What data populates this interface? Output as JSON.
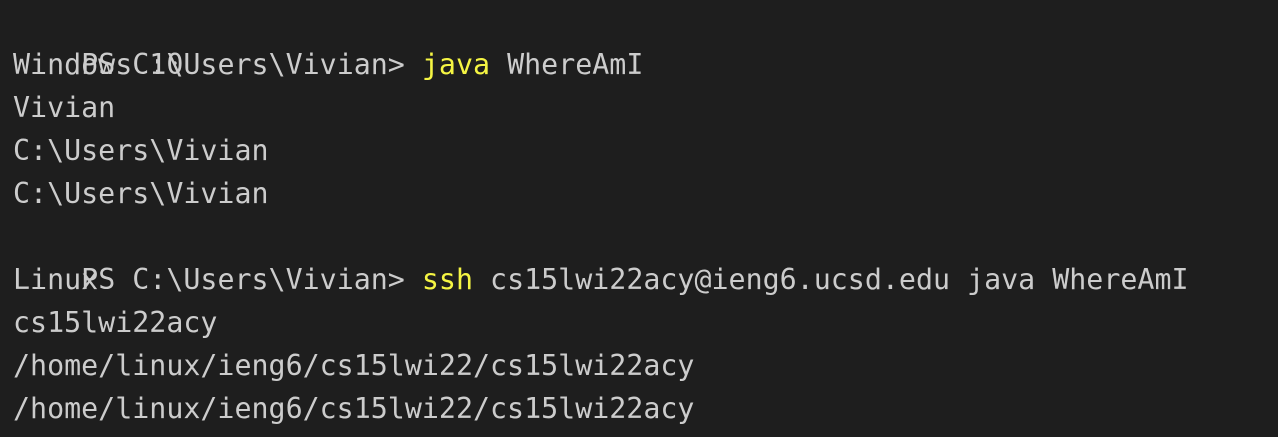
{
  "terminal": {
    "lines": [
      {
        "type": "command",
        "prompt": "PS C:\\Users\\Vivian> ",
        "command": "java",
        "args": " WhereAmI"
      },
      {
        "type": "output",
        "text": "Windows 10"
      },
      {
        "type": "output",
        "text": "Vivian"
      },
      {
        "type": "output",
        "text": "C:\\Users\\Vivian"
      },
      {
        "type": "output",
        "text": "C:\\Users\\Vivian"
      },
      {
        "type": "command",
        "prompt": "PS C:\\Users\\Vivian> ",
        "command": "ssh",
        "args": " cs15lwi22acy@ieng6.ucsd.edu java WhereAmI"
      },
      {
        "type": "output",
        "text": "Linux"
      },
      {
        "type": "output",
        "text": "cs15lwi22acy"
      },
      {
        "type": "output",
        "text": "/home/linux/ieng6/cs15lwi22/cs15lwi22acy"
      },
      {
        "type": "output",
        "text": "/home/linux/ieng6/cs15lwi22/cs15lwi22acy"
      }
    ]
  },
  "colors": {
    "background": "#1e1e1e",
    "text": "#cccccc",
    "command": "#f5f543"
  }
}
